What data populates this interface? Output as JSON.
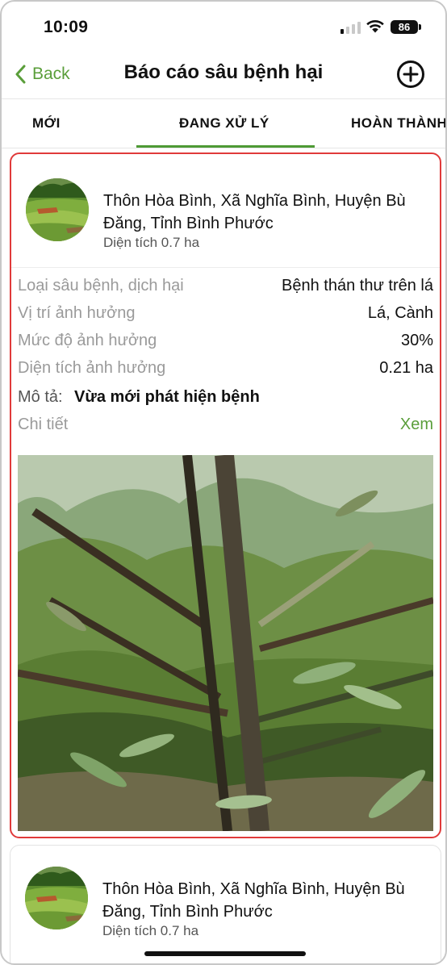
{
  "status_bar": {
    "time": "10:09",
    "battery": "86"
  },
  "nav": {
    "back_label": "Back",
    "title": "Báo cáo sâu bệnh hại"
  },
  "tabs": [
    {
      "label": "MỚI"
    },
    {
      "label": "ĐANG XỬ LÝ",
      "active": true
    },
    {
      "label": "HOÀN THÀNH"
    }
  ],
  "reports": [
    {
      "address": "Thôn Hòa Bình, Xã Nghĩa Bình, Huyện Bù Đăng, Tỉnh Bình Phước",
      "area": "Diện tích 0.7 ha",
      "fields": [
        {
          "label": "Loại sâu bệnh, dịch hại",
          "value": "Bệnh thán thư trên lá"
        },
        {
          "label": "Vị trí ảnh hưởng",
          "value": "Lá, Cành"
        },
        {
          "label": "Mức độ ảnh hưởng",
          "value": "30%"
        },
        {
          "label": "Diện tích ảnh hưởng",
          "value": "0.21 ha"
        }
      ],
      "description_label": "Mô tả:",
      "description": "Vừa mới phát hiện bệnh",
      "detail_label": "Chi tiết",
      "detail_link": "Xem"
    },
    {
      "address": "Thôn Hòa Bình, Xã Nghĩa Bình, Huyện Bù Đăng, Tỉnh Bình Phước",
      "area": "Diện tích 0.7 ha"
    }
  ],
  "colors": {
    "accent": "#5a9e3a",
    "selected_border": "#e03a3a",
    "tab_indicator": "#4e9a35"
  },
  "icons": {
    "back": "chevron-left-icon",
    "add": "plus-circle-icon"
  }
}
